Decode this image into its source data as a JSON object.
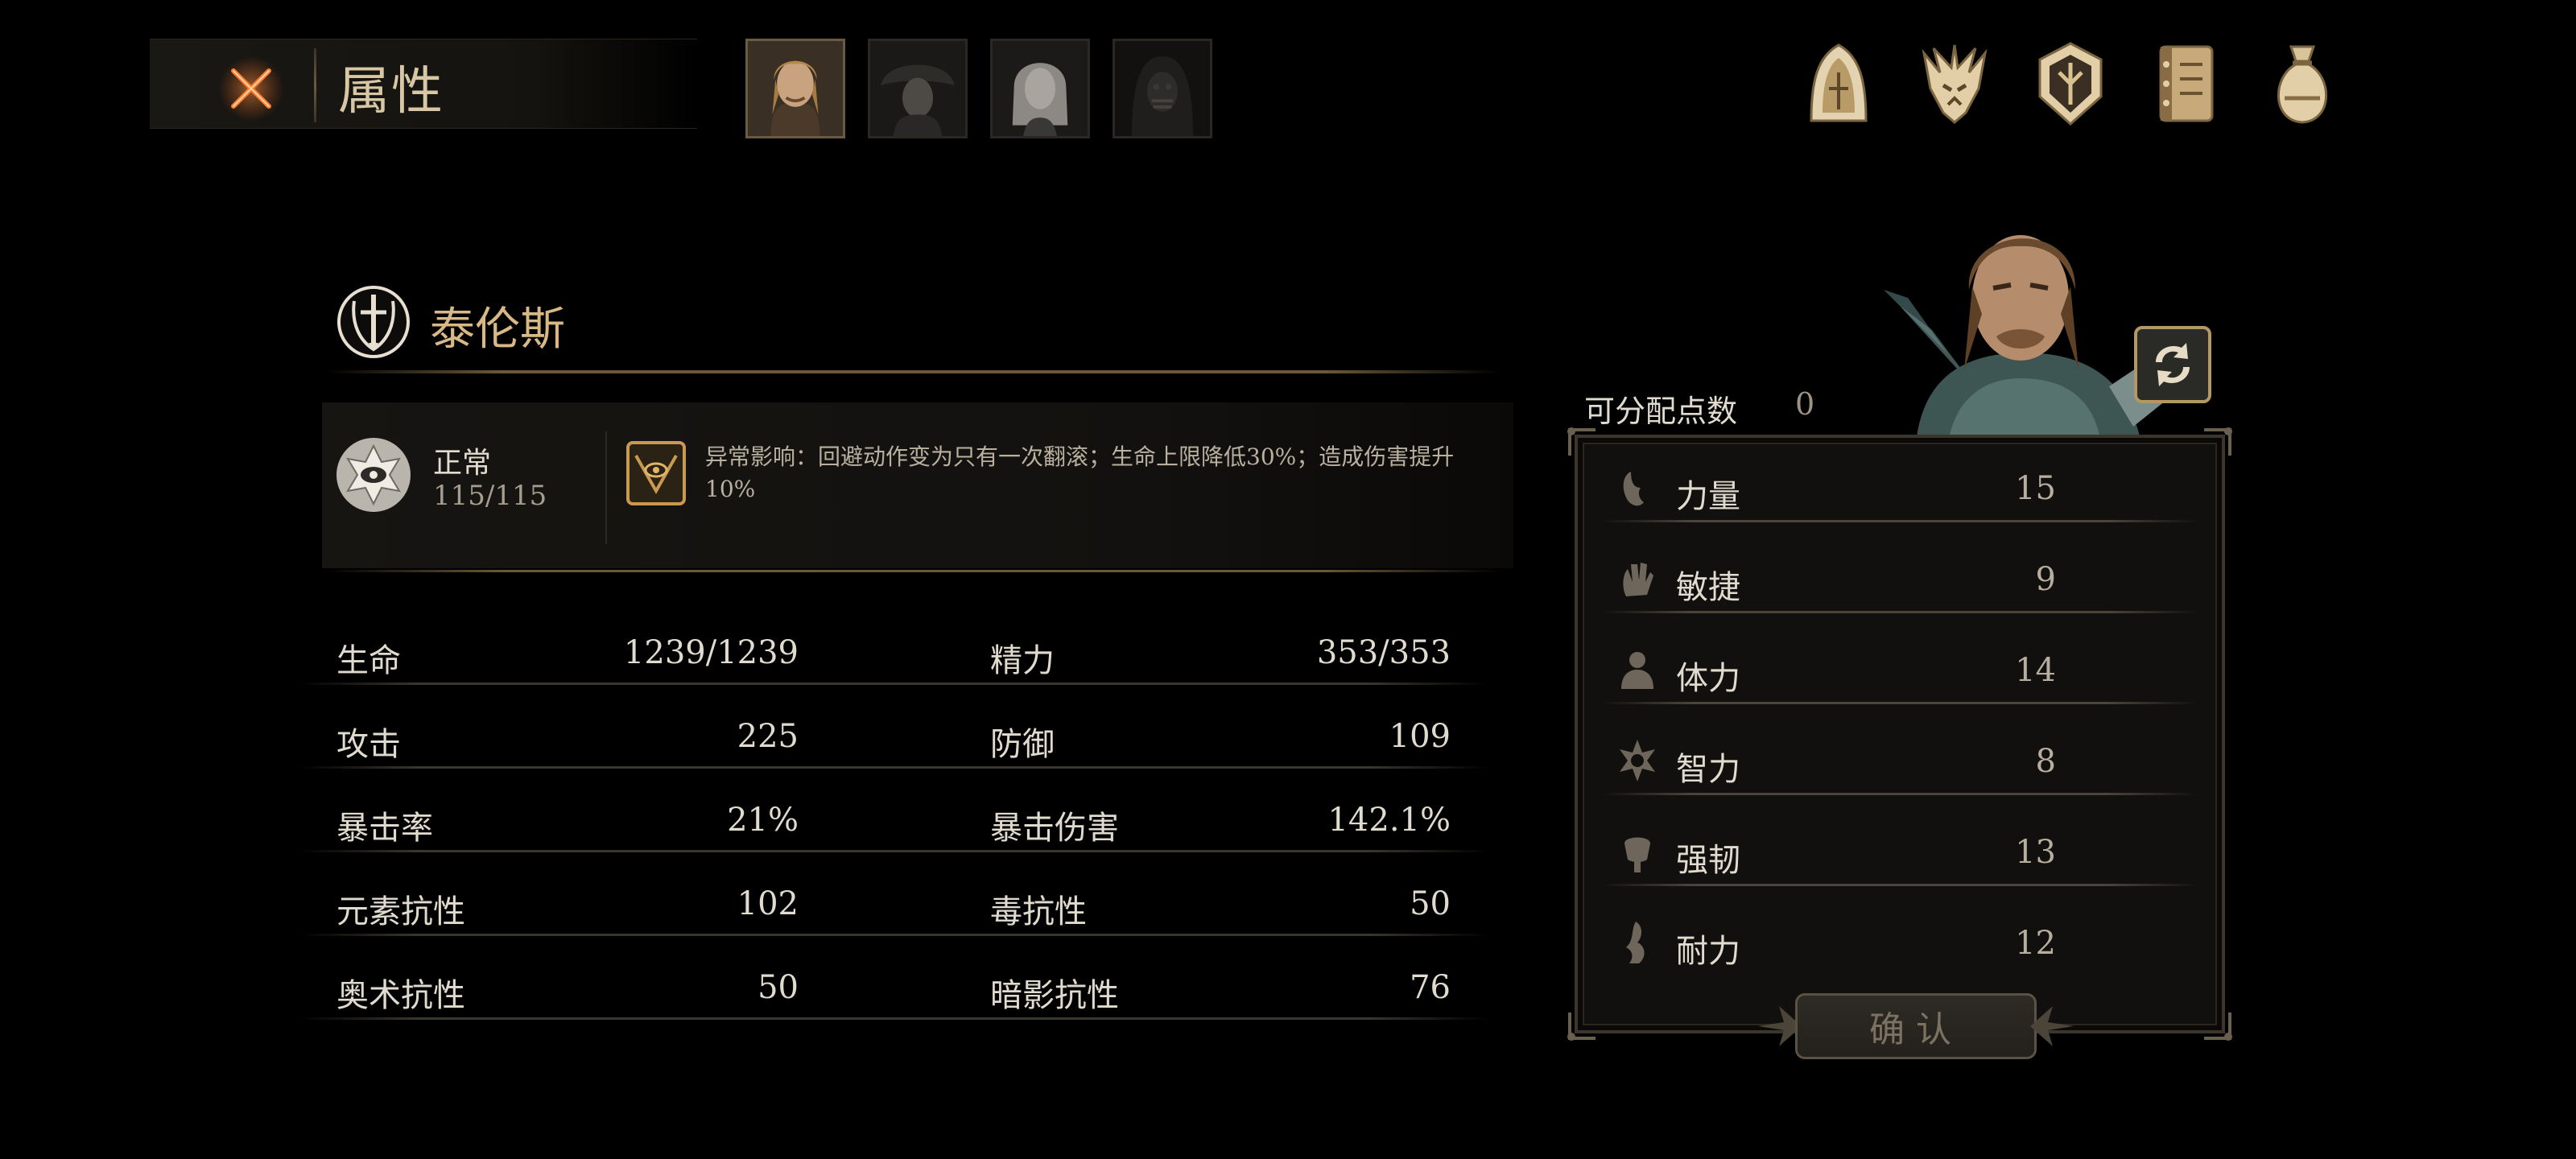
{
  "header": {
    "title": "属性",
    "character_tabs": [
      {
        "id": "swordsman",
        "active": true
      },
      {
        "id": "hooded-woman",
        "active": false
      },
      {
        "id": "pale-woman",
        "active": false
      },
      {
        "id": "masked-figure",
        "active": false
      }
    ],
    "menu_icons": [
      "skill-tree-icon",
      "beast-icon",
      "emblem-shield-icon",
      "codex-book-icon",
      "loot-bag-icon"
    ]
  },
  "character": {
    "name": "泰伦斯",
    "status": {
      "name": "正常",
      "value": "115/115",
      "effect": "异常影响：回避动作变为只有一次翻滚；生命上限降低30%；造成伤害提升10%"
    },
    "stats": [
      {
        "label": "生命",
        "value": "1239/1239"
      },
      {
        "label": "精力",
        "value": "353/353"
      },
      {
        "label": "攻击",
        "value": "225"
      },
      {
        "label": "防御",
        "value": "109"
      },
      {
        "label": "暴击率",
        "value": "21%"
      },
      {
        "label": "暴击伤害",
        "value": "142.1%"
      },
      {
        "label": "元素抗性",
        "value": "102"
      },
      {
        "label": "毒抗性",
        "value": "50"
      },
      {
        "label": "奥术抗性",
        "value": "50"
      },
      {
        "label": "暗影抗性",
        "value": "76"
      }
    ]
  },
  "attributes": {
    "points_label": "可分配点数",
    "points_value": "0",
    "items": [
      {
        "label": "力量",
        "value": "15"
      },
      {
        "label": "敏捷",
        "value": "9"
      },
      {
        "label": "体力",
        "value": "14"
      },
      {
        "label": "智力",
        "value": "8"
      },
      {
        "label": "强韧",
        "value": "13"
      },
      {
        "label": "耐力",
        "value": "12"
      }
    ],
    "confirm_label": "确认"
  },
  "colors": {
    "gold": "#d8b985",
    "text": "#e1dbcf",
    "close_accent": "#e8662a"
  }
}
